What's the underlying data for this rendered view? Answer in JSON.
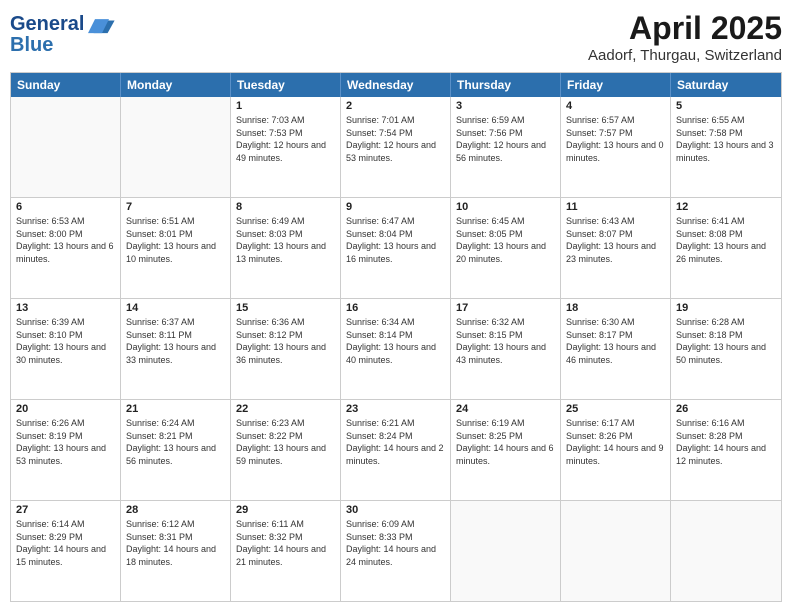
{
  "header": {
    "logo_line1": "General",
    "logo_line2": "Blue",
    "title": "April 2025",
    "subtitle": "Aadorf, Thurgau, Switzerland"
  },
  "calendar": {
    "days_of_week": [
      "Sunday",
      "Monday",
      "Tuesday",
      "Wednesday",
      "Thursday",
      "Friday",
      "Saturday"
    ],
    "weeks": [
      [
        {
          "day": "",
          "info": ""
        },
        {
          "day": "",
          "info": ""
        },
        {
          "day": "1",
          "info": "Sunrise: 7:03 AM\nSunset: 7:53 PM\nDaylight: 12 hours and 49 minutes."
        },
        {
          "day": "2",
          "info": "Sunrise: 7:01 AM\nSunset: 7:54 PM\nDaylight: 12 hours and 53 minutes."
        },
        {
          "day": "3",
          "info": "Sunrise: 6:59 AM\nSunset: 7:56 PM\nDaylight: 12 hours and 56 minutes."
        },
        {
          "day": "4",
          "info": "Sunrise: 6:57 AM\nSunset: 7:57 PM\nDaylight: 13 hours and 0 minutes."
        },
        {
          "day": "5",
          "info": "Sunrise: 6:55 AM\nSunset: 7:58 PM\nDaylight: 13 hours and 3 minutes."
        }
      ],
      [
        {
          "day": "6",
          "info": "Sunrise: 6:53 AM\nSunset: 8:00 PM\nDaylight: 13 hours and 6 minutes."
        },
        {
          "day": "7",
          "info": "Sunrise: 6:51 AM\nSunset: 8:01 PM\nDaylight: 13 hours and 10 minutes."
        },
        {
          "day": "8",
          "info": "Sunrise: 6:49 AM\nSunset: 8:03 PM\nDaylight: 13 hours and 13 minutes."
        },
        {
          "day": "9",
          "info": "Sunrise: 6:47 AM\nSunset: 8:04 PM\nDaylight: 13 hours and 16 minutes."
        },
        {
          "day": "10",
          "info": "Sunrise: 6:45 AM\nSunset: 8:05 PM\nDaylight: 13 hours and 20 minutes."
        },
        {
          "day": "11",
          "info": "Sunrise: 6:43 AM\nSunset: 8:07 PM\nDaylight: 13 hours and 23 minutes."
        },
        {
          "day": "12",
          "info": "Sunrise: 6:41 AM\nSunset: 8:08 PM\nDaylight: 13 hours and 26 minutes."
        }
      ],
      [
        {
          "day": "13",
          "info": "Sunrise: 6:39 AM\nSunset: 8:10 PM\nDaylight: 13 hours and 30 minutes."
        },
        {
          "day": "14",
          "info": "Sunrise: 6:37 AM\nSunset: 8:11 PM\nDaylight: 13 hours and 33 minutes."
        },
        {
          "day": "15",
          "info": "Sunrise: 6:36 AM\nSunset: 8:12 PM\nDaylight: 13 hours and 36 minutes."
        },
        {
          "day": "16",
          "info": "Sunrise: 6:34 AM\nSunset: 8:14 PM\nDaylight: 13 hours and 40 minutes."
        },
        {
          "day": "17",
          "info": "Sunrise: 6:32 AM\nSunset: 8:15 PM\nDaylight: 13 hours and 43 minutes."
        },
        {
          "day": "18",
          "info": "Sunrise: 6:30 AM\nSunset: 8:17 PM\nDaylight: 13 hours and 46 minutes."
        },
        {
          "day": "19",
          "info": "Sunrise: 6:28 AM\nSunset: 8:18 PM\nDaylight: 13 hours and 50 minutes."
        }
      ],
      [
        {
          "day": "20",
          "info": "Sunrise: 6:26 AM\nSunset: 8:19 PM\nDaylight: 13 hours and 53 minutes."
        },
        {
          "day": "21",
          "info": "Sunrise: 6:24 AM\nSunset: 8:21 PM\nDaylight: 13 hours and 56 minutes."
        },
        {
          "day": "22",
          "info": "Sunrise: 6:23 AM\nSunset: 8:22 PM\nDaylight: 13 hours and 59 minutes."
        },
        {
          "day": "23",
          "info": "Sunrise: 6:21 AM\nSunset: 8:24 PM\nDaylight: 14 hours and 2 minutes."
        },
        {
          "day": "24",
          "info": "Sunrise: 6:19 AM\nSunset: 8:25 PM\nDaylight: 14 hours and 6 minutes."
        },
        {
          "day": "25",
          "info": "Sunrise: 6:17 AM\nSunset: 8:26 PM\nDaylight: 14 hours and 9 minutes."
        },
        {
          "day": "26",
          "info": "Sunrise: 6:16 AM\nSunset: 8:28 PM\nDaylight: 14 hours and 12 minutes."
        }
      ],
      [
        {
          "day": "27",
          "info": "Sunrise: 6:14 AM\nSunset: 8:29 PM\nDaylight: 14 hours and 15 minutes."
        },
        {
          "day": "28",
          "info": "Sunrise: 6:12 AM\nSunset: 8:31 PM\nDaylight: 14 hours and 18 minutes."
        },
        {
          "day": "29",
          "info": "Sunrise: 6:11 AM\nSunset: 8:32 PM\nDaylight: 14 hours and 21 minutes."
        },
        {
          "day": "30",
          "info": "Sunrise: 6:09 AM\nSunset: 8:33 PM\nDaylight: 14 hours and 24 minutes."
        },
        {
          "day": "",
          "info": ""
        },
        {
          "day": "",
          "info": ""
        },
        {
          "day": "",
          "info": ""
        }
      ]
    ]
  }
}
